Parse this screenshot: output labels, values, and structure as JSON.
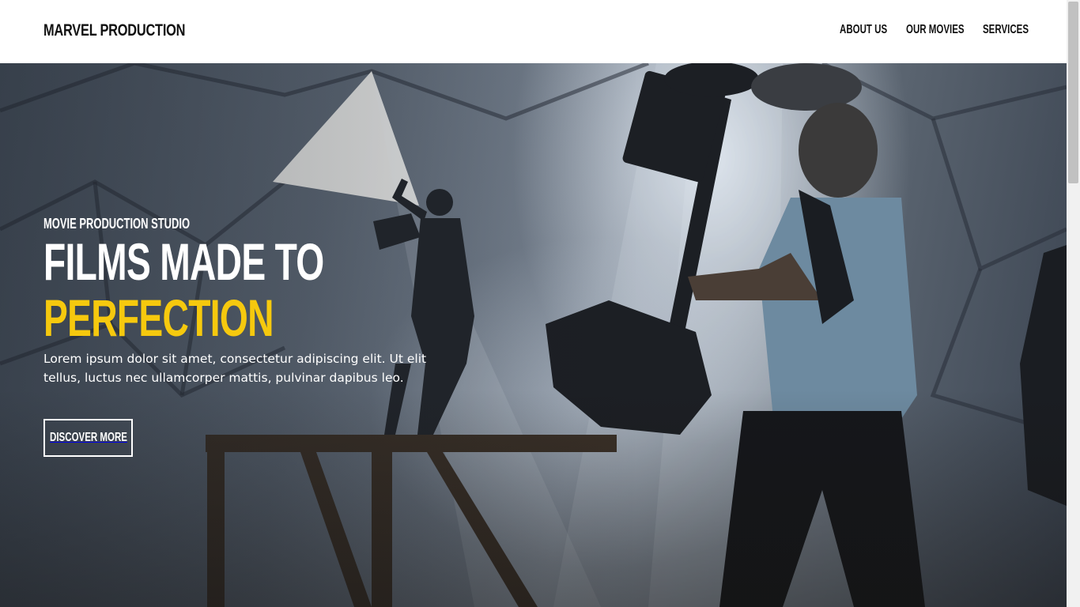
{
  "header": {
    "brand": "MARVEL PRODUCTION",
    "nav": [
      {
        "label": "ABOUT US"
      },
      {
        "label": "OUR MOVIES"
      },
      {
        "label": "SERVICES"
      }
    ]
  },
  "hero": {
    "eyebrow": "MOVIE PRODUCTION STUDIO",
    "headline_line1": "FILMS MADE TO",
    "headline_line2": "PERFECTION",
    "description": "Lorem ipsum dolor sit amet, consectetur adipiscing elit. Ut elit tellus, luctus nec ullamcorper mattis, pulvinar dapibus leo.",
    "cta_label": "DISCOVER MORE",
    "background_image": "film-set-camera-operator-photo"
  },
  "colors": {
    "accent": "#f6c90e",
    "header_bg": "#ffffff",
    "text_dark": "#111111",
    "text_light": "#ffffff"
  }
}
